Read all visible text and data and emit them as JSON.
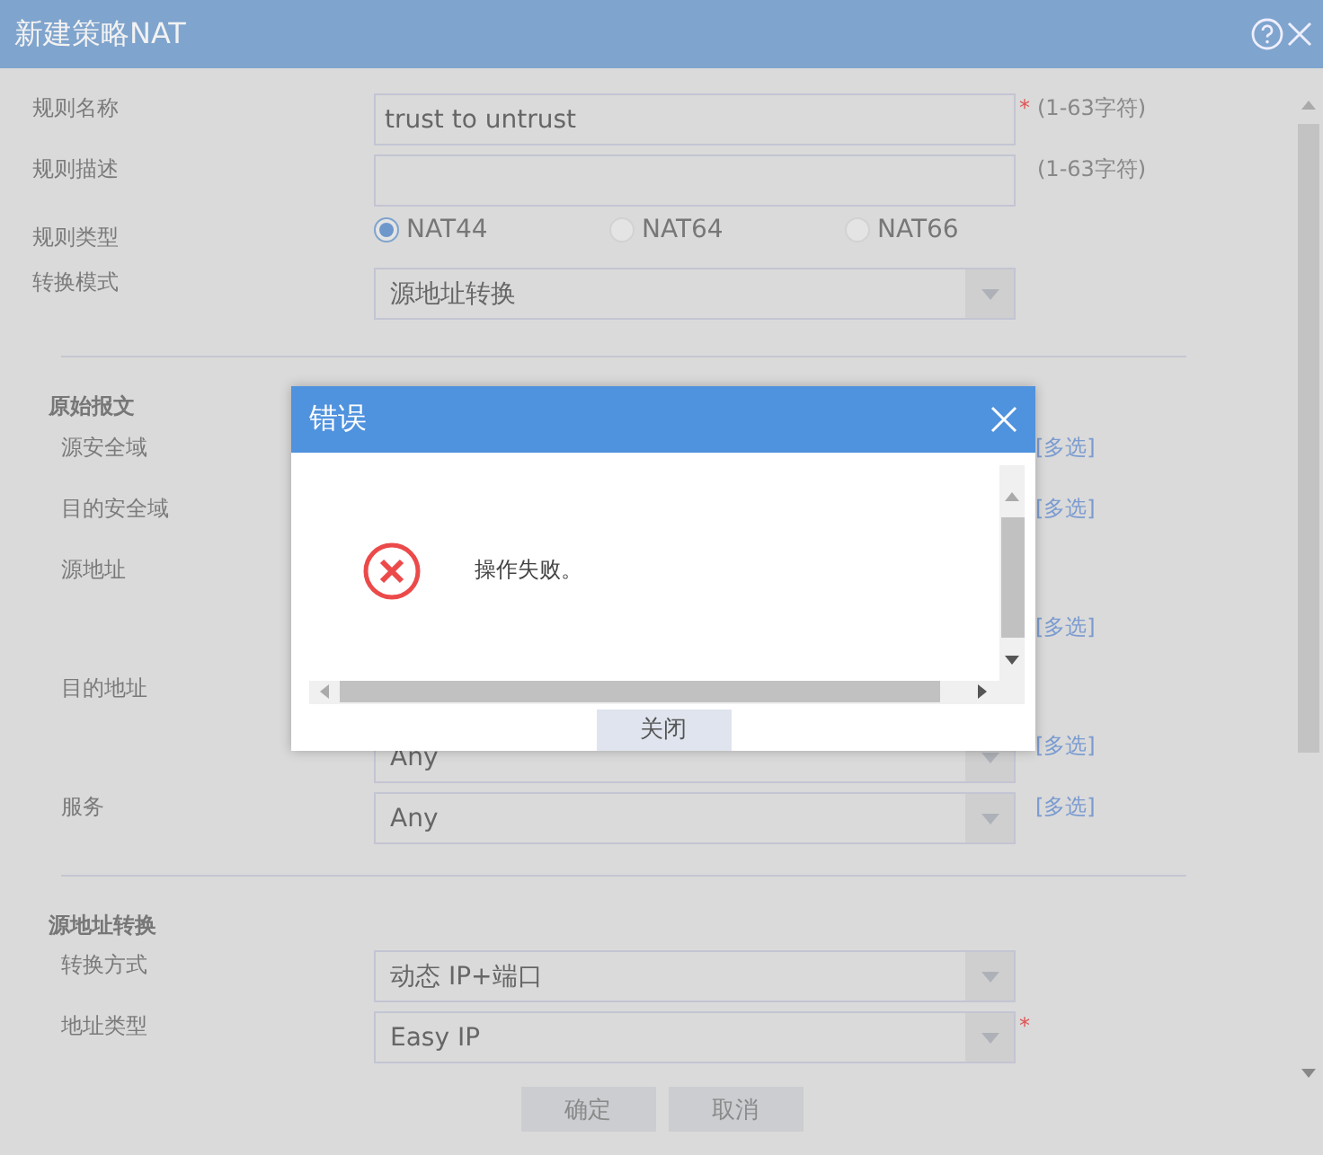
{
  "window": {
    "title": "新建策略NAT"
  },
  "basic_fields": [
    {
      "kind": "text",
      "label": "规则名称",
      "value": "trust to untrust",
      "required_mark": "*",
      "note": "(1-63字符)"
    },
    {
      "kind": "text",
      "label": "规则描述",
      "note": "(1-63字符)"
    },
    {
      "kind": "radio",
      "label": "规则类型",
      "options": [
        {
          "label": "NAT44",
          "selected": true
        },
        {
          "label": "NAT64",
          "selected": false
        },
        {
          "label": "NAT66",
          "selected": false
        }
      ]
    },
    {
      "kind": "select",
      "label": "转换模式",
      "value": "源地址转换"
    }
  ],
  "sections": [
    {
      "title": "原始报文",
      "fields": [
        {
          "kind": "covered",
          "label": "源安全域",
          "link": "[多选]"
        },
        {
          "kind": "covered",
          "label": "目的安全域",
          "link": "[多选]"
        },
        {
          "kind": "tall",
          "label": "源地址",
          "link": "[多选]"
        },
        {
          "kind": "tall",
          "label": "目的地址",
          "value": "Any",
          "link": "[多选]"
        },
        {
          "kind": "select",
          "label": "服务",
          "value": "Any",
          "link": "[多选]"
        }
      ]
    },
    {
      "title": "源地址转换",
      "fields": [
        {
          "kind": "select",
          "label": "转换方式",
          "value": "动态 IP+端口"
        },
        {
          "kind": "select",
          "label": "地址类型",
          "value": "Easy IP",
          "required_mark": "*"
        }
      ]
    }
  ],
  "buttons": [
    "确定",
    "取消"
  ],
  "dialog": {
    "title": "错误",
    "message": "操作失败。",
    "button": "关闭"
  }
}
